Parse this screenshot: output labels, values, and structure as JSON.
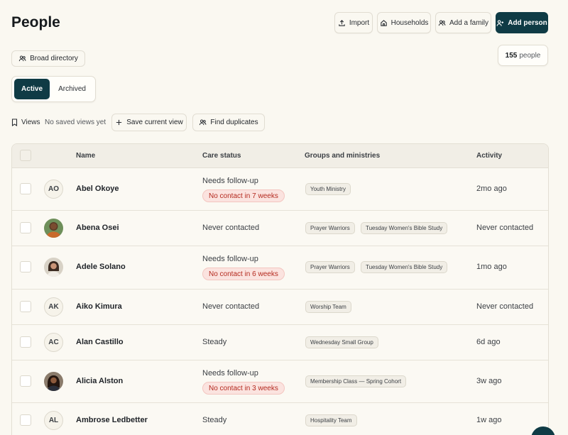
{
  "header": {
    "title": "People",
    "buttons": {
      "import": "Import",
      "households": "Households",
      "add_family": "Add a family",
      "add_person": "Add person"
    }
  },
  "directory": {
    "label": "Broad directory"
  },
  "count": {
    "number": "155",
    "suffix": "people"
  },
  "status_tabs": {
    "active": "Active",
    "archived": "Archived"
  },
  "views": {
    "label": "Views",
    "empty": "No saved views yet",
    "save": "Save current view",
    "duplicates": "Find duplicates"
  },
  "table": {
    "columns": {
      "name": "Name",
      "care": "Care status",
      "groups": "Groups and ministries",
      "activity": "Activity"
    },
    "rows": [
      {
        "initials": "AO",
        "name": "Abel Okoye",
        "care": "Needs follow-up",
        "badge": "No contact in 7 weeks",
        "groups": [
          "Youth Ministry"
        ],
        "activity": "2mo ago"
      },
      {
        "initials": "",
        "name": "Abena Osei",
        "care": "Never contacted",
        "badge": "",
        "groups": [
          "Prayer Warriors",
          "Tuesday Women's Bible Study"
        ],
        "activity": "Never contacted"
      },
      {
        "initials": "",
        "name": "Adele Solano",
        "care": "Needs follow-up",
        "badge": "No contact in 6 weeks",
        "groups": [
          "Prayer Warriors",
          "Tuesday Women's Bible Study"
        ],
        "activity": "1mo ago"
      },
      {
        "initials": "AK",
        "name": "Aiko Kimura",
        "care": "Never contacted",
        "badge": "",
        "groups": [
          "Worship Team"
        ],
        "activity": "Never contacted"
      },
      {
        "initials": "AC",
        "name": "Alan Castillo",
        "care": "Steady",
        "badge": "",
        "groups": [
          "Wednesday Small Group"
        ],
        "activity": "6d ago"
      },
      {
        "initials": "",
        "name": "Alicia Alston",
        "care": "Needs follow-up",
        "badge": "No contact in 3 weeks",
        "groups": [
          "Membership Class — Spring Cohort"
        ],
        "activity": "3w ago"
      },
      {
        "initials": "AL",
        "name": "Ambrose Ledbetter",
        "care": "Steady",
        "badge": "",
        "groups": [
          "Hospitality Team"
        ],
        "activity": "1w ago"
      }
    ]
  },
  "colors": {
    "accent": "#0f3b45",
    "badge_bg": "#fbe3df",
    "badge_text": "#b42a1f",
    "page_bg": "#faf8f1"
  }
}
